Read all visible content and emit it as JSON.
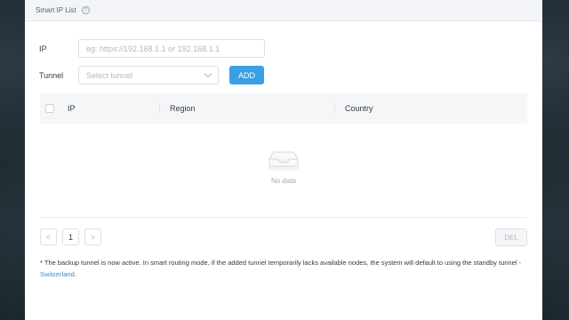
{
  "panel": {
    "title": "Smart IP List",
    "help_icon": "?"
  },
  "form": {
    "ip_label": "IP",
    "ip_placeholder": "eg: https://192.168.1.1 or 192.168.1.1",
    "tunnel_label": "Tunnel",
    "tunnel_placeholder": "Select tunnel",
    "add_label": "ADD"
  },
  "table": {
    "columns": [
      "IP",
      "Region",
      "Country"
    ],
    "rows": [],
    "empty_text": "No data"
  },
  "pagination": {
    "prev_icon": "<",
    "current_page": "1",
    "next_icon": ">"
  },
  "actions": {
    "del_label": "DEL"
  },
  "note": {
    "text": "* The backup tunnel is now active. In smart routing mode, if the added tunnel temporarily lacks available nodes, the system will default to using the standby tunnel - ",
    "link": "Switzerland",
    "suffix": "."
  },
  "colors": {
    "accent": "#3aa0e4",
    "link": "#2f8fd6",
    "header_bg": "#f2f4f7"
  }
}
